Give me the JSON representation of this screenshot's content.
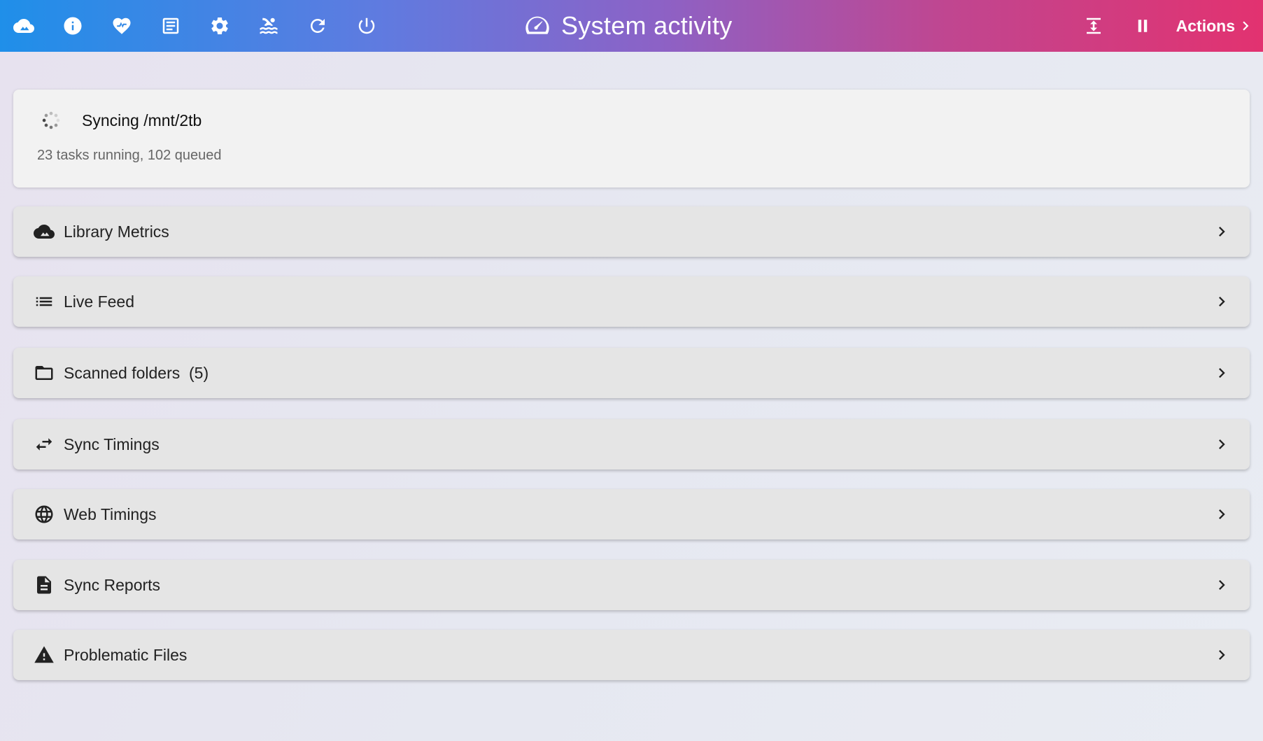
{
  "header": {
    "title": "System activity",
    "actions_label": "Actions",
    "nav_icons": [
      "cloud-icon",
      "info-icon",
      "heart-pulse-icon",
      "document-icon",
      "gear-icon",
      "swimmer-icon",
      "refresh-icon",
      "power-icon"
    ],
    "right_icons": [
      "expand-vertical-icon",
      "pause-icon"
    ]
  },
  "status": {
    "title": "Syncing /mnt/2tb",
    "subtitle": "23 tasks running, 102 queued"
  },
  "panels": [
    {
      "label": "Library Metrics",
      "icon": "cloud-icon"
    },
    {
      "label": "Live Feed",
      "icon": "list-icon"
    },
    {
      "label": "Scanned folders  (5)",
      "icon": "folder-icon"
    },
    {
      "label": "Sync Timings",
      "icon": "swap-arrows-icon"
    },
    {
      "label": "Web Timings",
      "icon": "globe-icon"
    },
    {
      "label": "Sync Reports",
      "icon": "file-document-icon"
    },
    {
      "label": "Problematic Files",
      "icon": "alert-icon"
    }
  ],
  "colors": {
    "header_gradient_start": "#1f8fe9",
    "header_gradient_end": "#e23270",
    "panel_bg": "#e5e5e5",
    "status_card_bg": "#f2f2f2"
  }
}
